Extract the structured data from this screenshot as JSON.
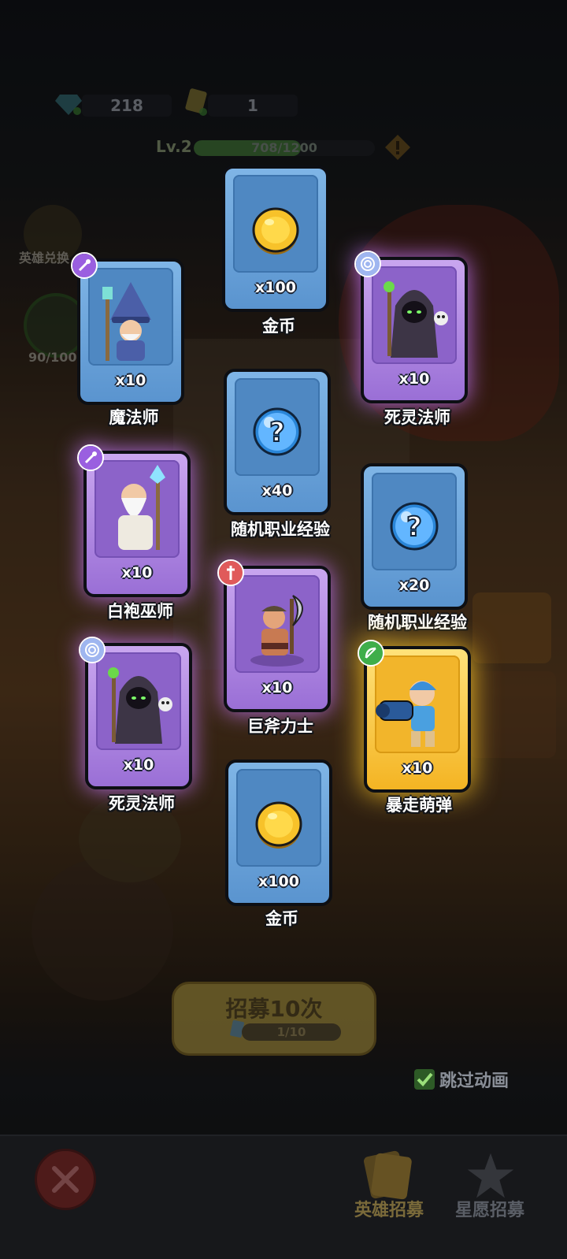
{
  "top_bar": {
    "gems": "218",
    "tickets": "1",
    "level": "Lv.2",
    "xp_text": "708/1200",
    "xp_fraction": 0.59
  },
  "side": {
    "hero_exchange_label": "英雄兑换",
    "star_progress": "90/100"
  },
  "rewards": [
    {
      "name": "金币",
      "qty": "x100",
      "rarity": "blue",
      "icon": "gold-coin"
    },
    {
      "name": "魔法师",
      "qty": "x10",
      "rarity": "blue",
      "icon": "wizard-hero"
    },
    {
      "name": "死灵法师",
      "qty": "x10",
      "rarity": "purple",
      "icon": "necromancer-hero"
    },
    {
      "name": "随机职业经验",
      "qty": "x40",
      "rarity": "blue",
      "icon": "question-orb"
    },
    {
      "name": "白袍巫师",
      "qty": "x10",
      "rarity": "purple",
      "icon": "white-wizard-hero"
    },
    {
      "name": "随机职业经验",
      "qty": "x20",
      "rarity": "blue",
      "icon": "question-orb"
    },
    {
      "name": "巨斧力士",
      "qty": "x10",
      "rarity": "purple",
      "icon": "axe-warrior-hero"
    },
    {
      "name": "死灵法师",
      "qty": "x10",
      "rarity": "purple",
      "icon": "necromancer-hero"
    },
    {
      "name": "暴走萌弹",
      "qty": "x10",
      "rarity": "gold",
      "icon": "cannon-hero"
    },
    {
      "name": "金币",
      "qty": "x100",
      "rarity": "blue",
      "icon": "gold-coin"
    }
  ],
  "recruit": {
    "button_label": "招募10次",
    "progress_text": "1/10"
  },
  "skip_animation": {
    "label": "跳过动画",
    "checked": true
  },
  "nav": {
    "tabs": [
      "英雄招募",
      "星愿招募"
    ],
    "active_tab": "英雄招募"
  },
  "colors": {
    "blue_card": "#6aa3dc",
    "purple_card": "#b08ae6",
    "gold_card": "#f7c53a"
  }
}
